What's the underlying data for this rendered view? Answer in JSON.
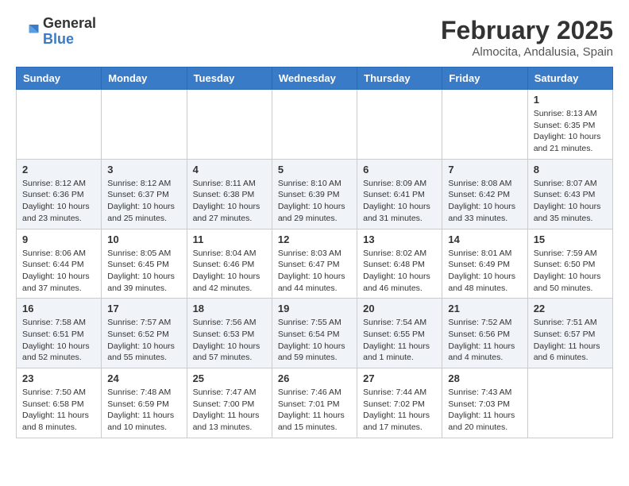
{
  "logo": {
    "general": "General",
    "blue": "Blue"
  },
  "title": "February 2025",
  "location": "Almocita, Andalusia, Spain",
  "days_of_week": [
    "Sunday",
    "Monday",
    "Tuesday",
    "Wednesday",
    "Thursday",
    "Friday",
    "Saturday"
  ],
  "weeks": [
    {
      "shaded": false,
      "days": [
        {
          "num": "",
          "info": ""
        },
        {
          "num": "",
          "info": ""
        },
        {
          "num": "",
          "info": ""
        },
        {
          "num": "",
          "info": ""
        },
        {
          "num": "",
          "info": ""
        },
        {
          "num": "",
          "info": ""
        },
        {
          "num": "1",
          "info": "Sunrise: 8:13 AM\nSunset: 6:35 PM\nDaylight: 10 hours and 21 minutes."
        }
      ]
    },
    {
      "shaded": true,
      "days": [
        {
          "num": "2",
          "info": "Sunrise: 8:12 AM\nSunset: 6:36 PM\nDaylight: 10 hours and 23 minutes."
        },
        {
          "num": "3",
          "info": "Sunrise: 8:12 AM\nSunset: 6:37 PM\nDaylight: 10 hours and 25 minutes."
        },
        {
          "num": "4",
          "info": "Sunrise: 8:11 AM\nSunset: 6:38 PM\nDaylight: 10 hours and 27 minutes."
        },
        {
          "num": "5",
          "info": "Sunrise: 8:10 AM\nSunset: 6:39 PM\nDaylight: 10 hours and 29 minutes."
        },
        {
          "num": "6",
          "info": "Sunrise: 8:09 AM\nSunset: 6:41 PM\nDaylight: 10 hours and 31 minutes."
        },
        {
          "num": "7",
          "info": "Sunrise: 8:08 AM\nSunset: 6:42 PM\nDaylight: 10 hours and 33 minutes."
        },
        {
          "num": "8",
          "info": "Sunrise: 8:07 AM\nSunset: 6:43 PM\nDaylight: 10 hours and 35 minutes."
        }
      ]
    },
    {
      "shaded": false,
      "days": [
        {
          "num": "9",
          "info": "Sunrise: 8:06 AM\nSunset: 6:44 PM\nDaylight: 10 hours and 37 minutes."
        },
        {
          "num": "10",
          "info": "Sunrise: 8:05 AM\nSunset: 6:45 PM\nDaylight: 10 hours and 39 minutes."
        },
        {
          "num": "11",
          "info": "Sunrise: 8:04 AM\nSunset: 6:46 PM\nDaylight: 10 hours and 42 minutes."
        },
        {
          "num": "12",
          "info": "Sunrise: 8:03 AM\nSunset: 6:47 PM\nDaylight: 10 hours and 44 minutes."
        },
        {
          "num": "13",
          "info": "Sunrise: 8:02 AM\nSunset: 6:48 PM\nDaylight: 10 hours and 46 minutes."
        },
        {
          "num": "14",
          "info": "Sunrise: 8:01 AM\nSunset: 6:49 PM\nDaylight: 10 hours and 48 minutes."
        },
        {
          "num": "15",
          "info": "Sunrise: 7:59 AM\nSunset: 6:50 PM\nDaylight: 10 hours and 50 minutes."
        }
      ]
    },
    {
      "shaded": true,
      "days": [
        {
          "num": "16",
          "info": "Sunrise: 7:58 AM\nSunset: 6:51 PM\nDaylight: 10 hours and 52 minutes."
        },
        {
          "num": "17",
          "info": "Sunrise: 7:57 AM\nSunset: 6:52 PM\nDaylight: 10 hours and 55 minutes."
        },
        {
          "num": "18",
          "info": "Sunrise: 7:56 AM\nSunset: 6:53 PM\nDaylight: 10 hours and 57 minutes."
        },
        {
          "num": "19",
          "info": "Sunrise: 7:55 AM\nSunset: 6:54 PM\nDaylight: 10 hours and 59 minutes."
        },
        {
          "num": "20",
          "info": "Sunrise: 7:54 AM\nSunset: 6:55 PM\nDaylight: 11 hours and 1 minute."
        },
        {
          "num": "21",
          "info": "Sunrise: 7:52 AM\nSunset: 6:56 PM\nDaylight: 11 hours and 4 minutes."
        },
        {
          "num": "22",
          "info": "Sunrise: 7:51 AM\nSunset: 6:57 PM\nDaylight: 11 hours and 6 minutes."
        }
      ]
    },
    {
      "shaded": false,
      "days": [
        {
          "num": "23",
          "info": "Sunrise: 7:50 AM\nSunset: 6:58 PM\nDaylight: 11 hours and 8 minutes."
        },
        {
          "num": "24",
          "info": "Sunrise: 7:48 AM\nSunset: 6:59 PM\nDaylight: 11 hours and 10 minutes."
        },
        {
          "num": "25",
          "info": "Sunrise: 7:47 AM\nSunset: 7:00 PM\nDaylight: 11 hours and 13 minutes."
        },
        {
          "num": "26",
          "info": "Sunrise: 7:46 AM\nSunset: 7:01 PM\nDaylight: 11 hours and 15 minutes."
        },
        {
          "num": "27",
          "info": "Sunrise: 7:44 AM\nSunset: 7:02 PM\nDaylight: 11 hours and 17 minutes."
        },
        {
          "num": "28",
          "info": "Sunrise: 7:43 AM\nSunset: 7:03 PM\nDaylight: 11 hours and 20 minutes."
        },
        {
          "num": "",
          "info": ""
        }
      ]
    }
  ]
}
